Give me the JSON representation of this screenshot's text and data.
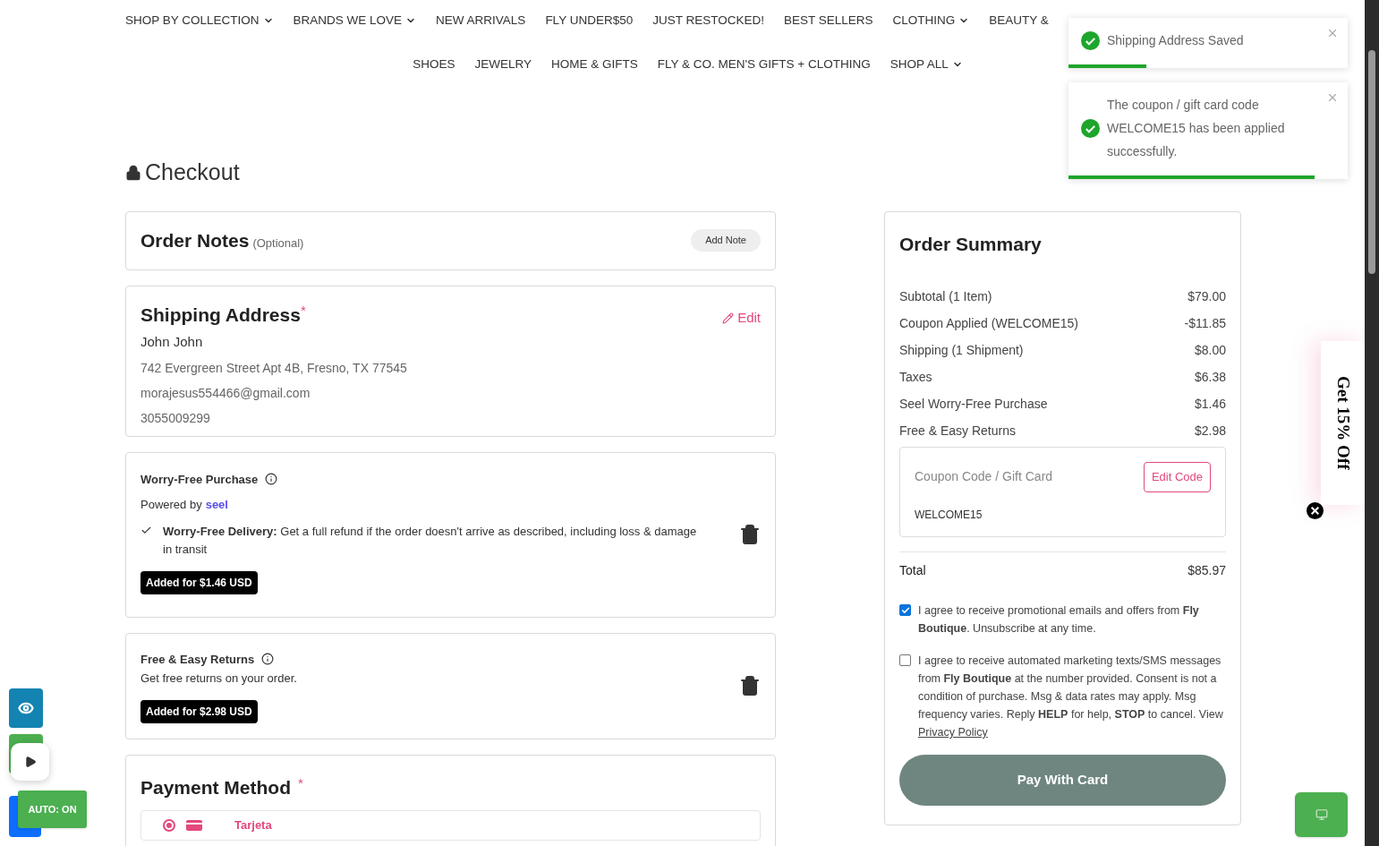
{
  "nav": [
    [
      {
        "label": "SHOP BY COLLECTION",
        "dropdown": true
      },
      {
        "label": "BRANDS WE LOVE",
        "dropdown": true
      },
      {
        "label": "NEW ARRIVALS",
        "dropdown": false
      },
      {
        "label": "FLY UNDER$50",
        "dropdown": false
      },
      {
        "label": "JUST RESTOCKED!",
        "dropdown": false
      },
      {
        "label": "BEST SELLERS",
        "dropdown": false
      },
      {
        "label": "CLOTHING",
        "dropdown": true
      },
      {
        "label": "BEAUTY &",
        "dropdown": false
      }
    ],
    [
      {
        "label": "SHOES",
        "dropdown": false
      },
      {
        "label": "JEWELRY",
        "dropdown": false
      },
      {
        "label": "HOME & GIFTS",
        "dropdown": false
      },
      {
        "label": "FLY & CO. MEN'S GIFTS + CLOTHING",
        "dropdown": false
      },
      {
        "label": "SHOP ALL",
        "dropdown": true
      }
    ]
  ],
  "toasts": [
    {
      "message": "Shipping Address Saved",
      "level": 0.28
    },
    {
      "message": "The coupon / gift card code WELCOME15 has been applied successfully.",
      "level": 0.88
    }
  ],
  "page_title": "Checkout",
  "order_notes": {
    "title": "Order Notes",
    "hint": "(Optional)",
    "button": "Add Note"
  },
  "shipping": {
    "title": "Shipping Address",
    "required_mark": "*",
    "edit": "Edit",
    "name": "John John",
    "lines": [
      "742 Evergreen Street Apt 4B, Fresno, TX 77545",
      "morajesus554466@gmail.com",
      "3055009299"
    ]
  },
  "protection": {
    "title": "Worry-Free Purchase",
    "powered_by": "Powered by",
    "brand": "seel",
    "feature": "**Worry-Free Delivery:** Get a full refund if the order doesn't arrive as described, including loss & damage in transit",
    "badge": "Added for $1.46 USD"
  },
  "returns": {
    "title": "Free & Easy Returns",
    "text": "Get free returns on your order.",
    "badge": "Added for $2.98 USD"
  },
  "payment": {
    "title": "Payment Method",
    "required_mark": "*",
    "option": {
      "label": "Tarjeta",
      "selected": true
    }
  },
  "summary": {
    "title": "Order Summary",
    "lines": [
      {
        "label": "Subtotal (1 Item)",
        "amount": "$79.00"
      },
      {
        "label": "Coupon Applied (WELCOME15)",
        "amount": "-$11.85"
      },
      {
        "label": "Shipping (1 Shipment)",
        "amount": "$8.00"
      },
      {
        "label": "Taxes",
        "amount": "$6.38"
      },
      {
        "label": "Seel Worry-Free Purchase",
        "amount": "$1.46"
      },
      {
        "label": "Free & Easy Returns",
        "amount": "$2.98"
      }
    ],
    "coupon": {
      "placeholder": "Coupon Code / Gift Card",
      "button": "Edit Code",
      "code": "WELCOME15"
    },
    "total": {
      "label": "Total",
      "amount": "$85.97"
    },
    "consents": [
      {
        "checked": true,
        "text": "I agree to receive promotional emails and offers from **Fly Boutique**. Unsubscribe at any time."
      },
      {
        "checked": false,
        "text": "I agree to receive automated marketing texts/SMS messages from **Fly Boutique** at the number provided. Consent is not a condition of purchase. Msg & data rates may apply. Msg frequency varies. Reply **HELP** for help, **STOP** to cancel. View",
        "link": "Privacy Policy"
      }
    ],
    "pay_button": "Pay With Card"
  },
  "promo_tab": {
    "text": "Get 15% Off"
  },
  "widgets": {
    "auto_label": "AUTO: ON"
  }
}
